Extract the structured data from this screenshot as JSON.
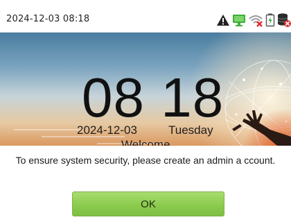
{
  "status_bar": {
    "datetime": "2024-12-03 08:18",
    "icons": [
      "warning-icon",
      "network-connected-icon",
      "wifi-disconnected-icon",
      "battery-icon",
      "server-disconnected-icon"
    ],
    "colors": {
      "warning": "#222222",
      "network": "#3fae3a",
      "wifi_off": "#9a9a9a",
      "alert_red": "#e02b2b",
      "battery": "#2e9e3a"
    }
  },
  "clock": {
    "time": "08 18",
    "date": "2024-12-03",
    "day": "Tuesday",
    "welcome": "Welcome"
  },
  "dialog": {
    "message": "To ensure system security, please create an admin a ccount.",
    "ok_label": "OK",
    "ok_color": "#8bcb4e"
  }
}
